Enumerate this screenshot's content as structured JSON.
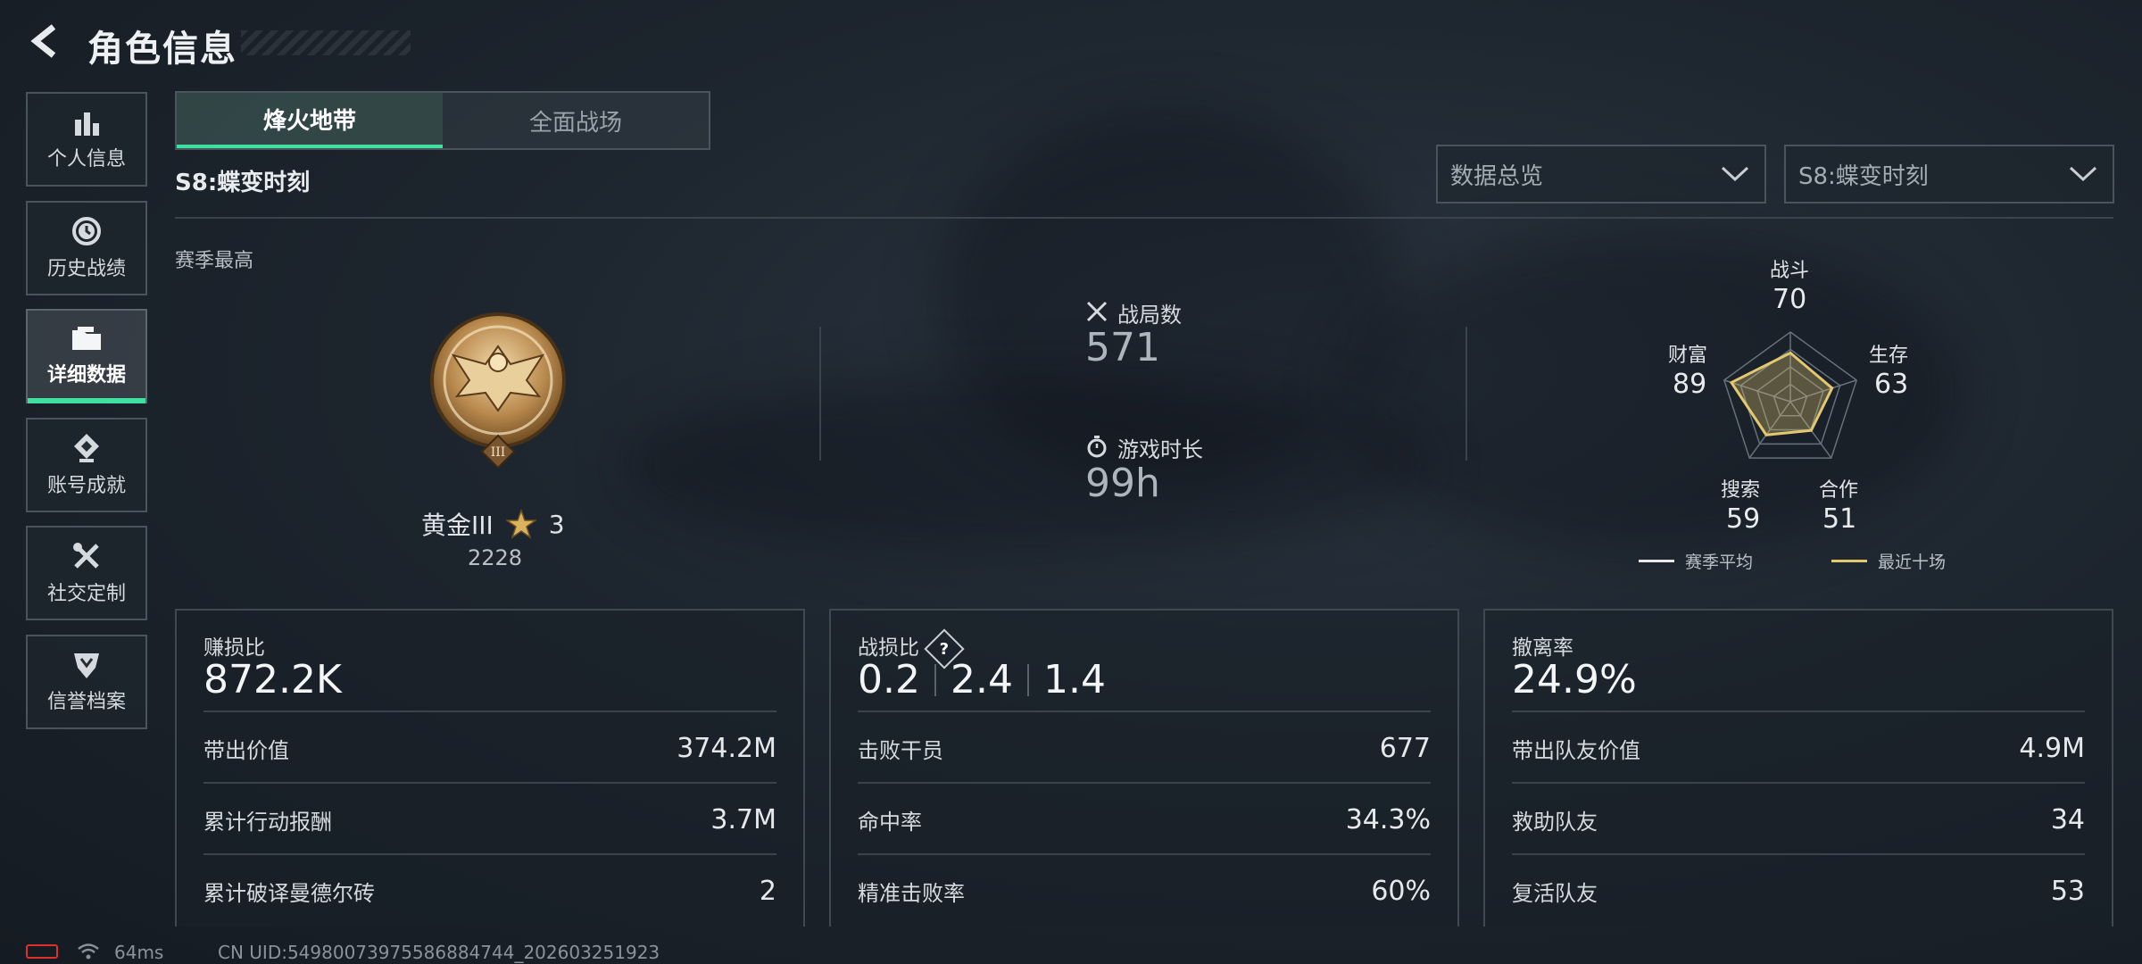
{
  "header": {
    "title": "角色信息",
    "back_icon": "chevron-left-icon"
  },
  "sidebar": {
    "items": [
      {
        "label": "个人信息",
        "icon": "bar-chart-icon",
        "active": false
      },
      {
        "label": "历史战绩",
        "icon": "clock-history-icon",
        "active": false
      },
      {
        "label": "详细数据",
        "icon": "folder-icon",
        "active": true
      },
      {
        "label": "账号成就",
        "icon": "achievement-icon",
        "active": false
      },
      {
        "label": "社交定制",
        "icon": "tools-icon",
        "active": false
      },
      {
        "label": "信誉档案",
        "icon": "reputation-icon",
        "active": false
      }
    ]
  },
  "tabs": [
    {
      "label": "烽火地带",
      "active": true
    },
    {
      "label": "全面战场",
      "active": false
    }
  ],
  "season_title": "S8:蝶变时刻",
  "filters": {
    "data_overview": "数据总览",
    "season": "S8:蝶变时刻"
  },
  "season_best": {
    "label": "赛季最高",
    "rank": "黄金III",
    "stars": "3",
    "points": "2228"
  },
  "summary": {
    "matches_label": "战局数",
    "matches_value": "571",
    "playtime_label": "游戏时长",
    "playtime_value": "99h"
  },
  "radar": {
    "axes": [
      {
        "label": "战斗",
        "value": "70"
      },
      {
        "label": "生存",
        "value": "63"
      },
      {
        "label": "合作",
        "value": "51"
      },
      {
        "label": "搜索",
        "value": "59"
      },
      {
        "label": "财富",
        "value": "89"
      }
    ],
    "recent_values": [
      70,
      63,
      51,
      59,
      89
    ],
    "legend": {
      "season_avg": "赛季平均",
      "recent_ten": "最近十场"
    },
    "colors": {
      "season_avg": "#e8e8e8",
      "recent_ten": "#e3c870"
    }
  },
  "panels": {
    "profit": {
      "label": "赚损比",
      "value": "872.2K",
      "rows": [
        {
          "k": "带出价值",
          "v": "374.2M"
        },
        {
          "k": "累计行动报酬",
          "v": "3.7M"
        },
        {
          "k": "累计破译曼德尔砖",
          "v": "2"
        }
      ]
    },
    "kd": {
      "label": "战损比",
      "help": "?",
      "values": [
        "0.2",
        "2.4",
        "1.4"
      ],
      "rows": [
        {
          "k": "击败干员",
          "v": "677"
        },
        {
          "k": "命中率",
          "v": "34.3%"
        },
        {
          "k": "精准击败率",
          "v": "60%"
        }
      ]
    },
    "extract": {
      "label": "撤离率",
      "value": "24.9%",
      "rows": [
        {
          "k": "带出队友价值",
          "v": "4.9M"
        },
        {
          "k": "救助队友",
          "v": "34"
        },
        {
          "k": "复活队友",
          "v": "53"
        }
      ]
    }
  },
  "footer": {
    "ping": "64ms",
    "uid": "CN UID:5498007397558688474​4_202603251923"
  },
  "colors": {
    "accent": "#3fe0a0",
    "battery": "#e0302e"
  }
}
